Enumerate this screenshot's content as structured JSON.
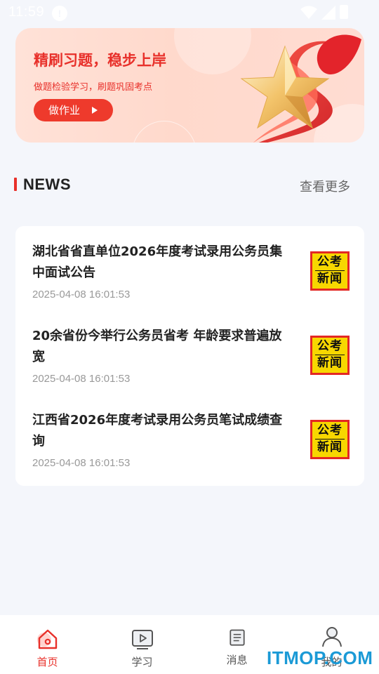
{
  "status_bar": {
    "time": "11:59",
    "info_icon": "info-icon",
    "wifi_icon": "wifi-icon",
    "signal_icon": "signal-icon",
    "battery_icon": "battery-icon"
  },
  "banner": {
    "title": "精刷习题，稳步上岸",
    "subtitle": "做题检验学习，刷题巩固考点",
    "button_label": "做作业",
    "art_icon": "star-ribbon-icon",
    "colors": {
      "accent": "#e8302a",
      "button": "#ee3a2c",
      "background": "#ffdcd0"
    }
  },
  "news_section": {
    "title": "NEWS",
    "more_label": "查看更多",
    "items": [
      {
        "title": "湖北省省直单位2026年度考试录用公务员集中面试公告",
        "date": "2025-04-08 16:01:53",
        "thumb_line1": "公考",
        "thumb_line2": "新闻"
      },
      {
        "title": "20余省份今举行公务员省考 年龄要求普遍放宽",
        "date": "2025-04-08 16:01:53",
        "thumb_line1": "公考",
        "thumb_line2": "新闻"
      },
      {
        "title": "江西省2026年度考试录用公务员笔试成绩查询",
        "date": "2025-04-08 16:01:53",
        "thumb_line1": "公考",
        "thumb_line2": "新闻"
      }
    ]
  },
  "bottom_nav": {
    "active": "首页",
    "items": [
      {
        "label": "首页",
        "icon": "home-icon"
      },
      {
        "label": "学习",
        "icon": "video-play-icon"
      },
      {
        "label": "消息",
        "icon": "document-list-icon"
      },
      {
        "label": "我的",
        "icon": "user-icon"
      }
    ]
  },
  "watermark": "ITMOP.COM"
}
